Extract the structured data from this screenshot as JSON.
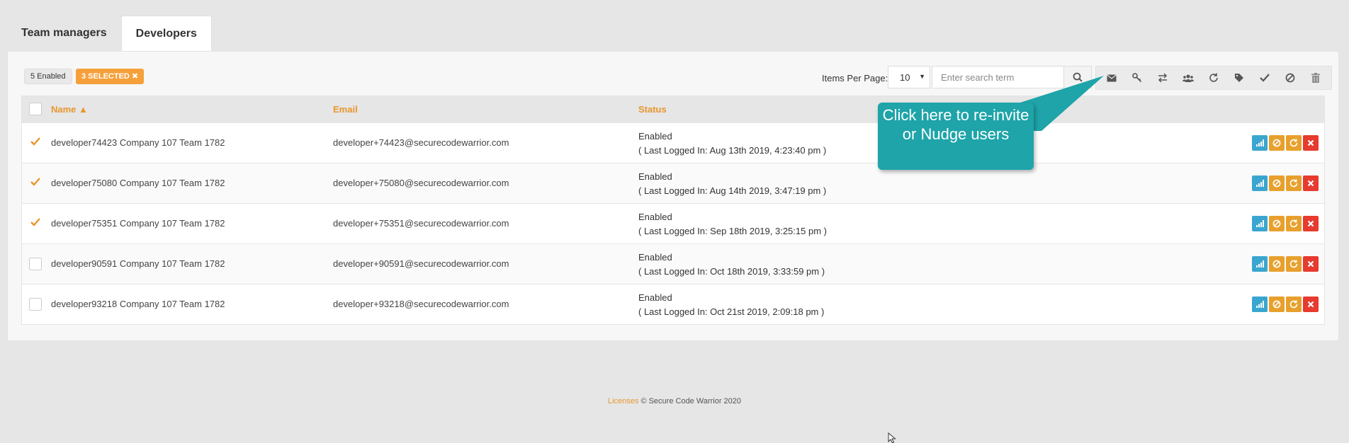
{
  "tabs": [
    {
      "label": "Team managers",
      "active": false
    },
    {
      "label": "Developers",
      "active": true
    }
  ],
  "badges": {
    "enabled": "5 Enabled",
    "selected": "3 SELECTED ✖"
  },
  "controls": {
    "items_per_page_label": "Items Per Page:",
    "items_per_page_value": "10",
    "search_placeholder": "Enter search term"
  },
  "toolbar_icons": [
    "envelope-icon",
    "key-icon",
    "transfer-icon",
    "users-icon",
    "refresh-icon",
    "tag-icon",
    "check-icon",
    "ban-icon",
    "trash-icon"
  ],
  "table": {
    "headers": {
      "name": "Name",
      "email": "Email",
      "status": "Status"
    },
    "rows": [
      {
        "selected": true,
        "name": "developer74423 Company 107 Team 1782",
        "email": "developer+74423@securecodewarrior.com",
        "status": "Enabled",
        "last_login": "( Last Logged In: Aug 13th 2019, 4:23:40 pm )"
      },
      {
        "selected": true,
        "name": "developer75080 Company 107 Team 1782",
        "email": "developer+75080@securecodewarrior.com",
        "status": "Enabled",
        "last_login": "( Last Logged In: Aug 14th 2019, 3:47:19 pm )"
      },
      {
        "selected": true,
        "name": "developer75351 Company 107 Team 1782",
        "email": "developer+75351@securecodewarrior.com",
        "status": "Enabled",
        "last_login": "( Last Logged In: Sep 18th 2019, 3:25:15 pm )"
      },
      {
        "selected": false,
        "name": "developer90591 Company 107 Team 1782",
        "email": "developer+90591@securecodewarrior.com",
        "status": "Enabled",
        "last_login": "( Last Logged In: Oct 18th 2019, 3:33:59 pm )"
      },
      {
        "selected": false,
        "name": "developer93218 Company 107 Team 1782",
        "email": "developer+93218@securecodewarrior.com",
        "status": "Enabled",
        "last_login": "( Last Logged In: Oct 21st 2019, 2:09:18 pm )"
      }
    ]
  },
  "callout": {
    "text": "Click here to re-invite or Nudge users"
  },
  "footer": {
    "licenses": "Licenses",
    "copyright": "© Secure Code Warrior 2020"
  },
  "colors": {
    "accent": "#e8962d",
    "callout": "#1ea4a9",
    "stats": "#3aa6d0",
    "delete": "#e63b2e"
  }
}
